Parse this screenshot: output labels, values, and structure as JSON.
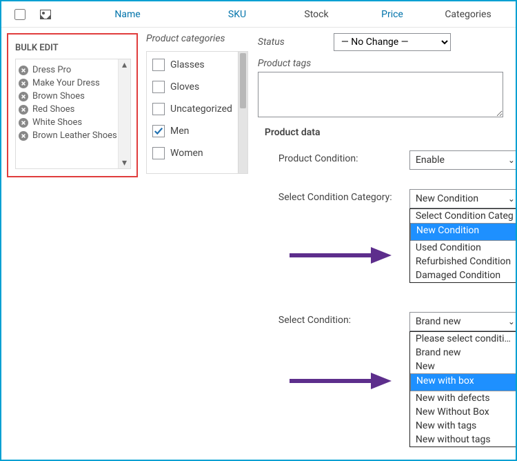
{
  "header": {
    "name": "Name",
    "sku": "SKU",
    "stock": "Stock",
    "price": "Price",
    "categories": "Categories"
  },
  "bulk": {
    "title": "BULK EDIT",
    "items": [
      "Dress Pro",
      "Make Your Dress",
      "Brown Shoes",
      "Red Shoes",
      "White Shoes",
      "Brown Leather Shoes"
    ]
  },
  "categories": {
    "title": "Product categories",
    "items": [
      {
        "label": "Glasses",
        "checked": false
      },
      {
        "label": "Gloves",
        "checked": false
      },
      {
        "label": "Uncategorized",
        "checked": false
      },
      {
        "label": "Men",
        "checked": true
      },
      {
        "label": "Women",
        "checked": false
      }
    ]
  },
  "status": {
    "label": "Status",
    "selected": "— No Change —"
  },
  "tags": {
    "label": "Product tags"
  },
  "product_data": {
    "header": "Product data",
    "condition_enable": {
      "label": "Product Condition:",
      "selected": "Enable"
    },
    "condition_category": {
      "label": "Select Condition Category:",
      "selected": "New Condition",
      "options": [
        "Select Condition Categ",
        "New Condition",
        "Used Condition",
        "Refurbished Condition",
        "Damaged Condition"
      ],
      "highlighted_index": 1
    },
    "select_condition": {
      "label": "Select Condition:",
      "selected": "Brand new",
      "options": [
        "Please select condition",
        "Brand new",
        "New",
        "New with box",
        "New with defects",
        "New Without Box",
        "New with tags",
        "New without tags"
      ],
      "highlighted_index": 3
    }
  },
  "colors": {
    "frame": "#00a0d2",
    "link": "#0073aa",
    "highlight_red": "#e03c3c",
    "select_highlight": "#1e90ff",
    "arrow": "#5d2e8c"
  }
}
